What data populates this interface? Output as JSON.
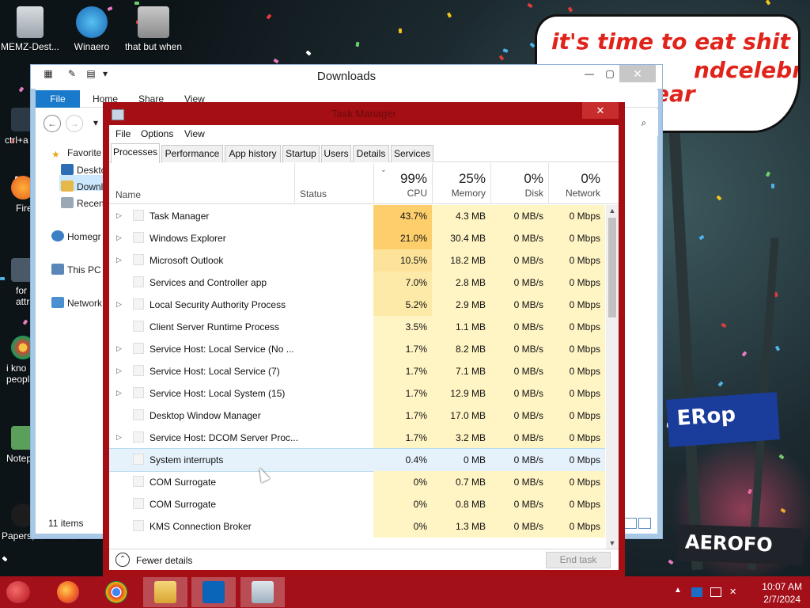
{
  "desktop": {
    "icons_top": [
      {
        "label": "MEMZ-Dest..."
      },
      {
        "label": "Winaero Tweaker"
      },
      {
        "label": "that but when its c#"
      }
    ],
    "icons_left": [
      {
        "label": "ctrl+a"
      },
      {
        "label": "Fire"
      },
      {
        "label": "for attra"
      },
      {
        "label": "i kno peopl"
      },
      {
        "label": "Notep"
      },
      {
        "label": "Papers, Please Forza Ho"
      }
    ],
    "overlay_text": [
      "it's time to eat shit",
      "ndcelebrate",
      "ear"
    ],
    "sign_text": "ERop",
    "sign_text_2": "AEROFO"
  },
  "explorer": {
    "title": "Downloads",
    "ribbon_tabs": [
      "File",
      "Home",
      "Share",
      "View"
    ],
    "sidebar": {
      "favorites": "Favorite",
      "items": [
        "Deskto",
        "Downl",
        "Recen"
      ],
      "homegroup": "Homegr",
      "this_pc": "This PC",
      "network": "Network"
    },
    "status": "11 items"
  },
  "taskmanager": {
    "title": "Task Manager",
    "menu": [
      "File",
      "Options",
      "View"
    ],
    "tabs": [
      "Processes",
      "Performance",
      "App history",
      "Startup",
      "Users",
      "Details",
      "Services"
    ],
    "active_tab": "Processes",
    "columns": {
      "name": "Name",
      "status": "Status",
      "cpu": {
        "pct": "99%",
        "label": "CPU"
      },
      "memory": {
        "pct": "25%",
        "label": "Memory"
      },
      "disk": {
        "pct": "0%",
        "label": "Disk"
      },
      "network": {
        "pct": "0%",
        "label": "Network"
      }
    },
    "processes": [
      {
        "name": "Task Manager",
        "expandable": true,
        "cpu": "43.7%",
        "mem": "4.3 MB",
        "disk": "0 MB/s",
        "net": "0 Mbps"
      },
      {
        "name": "Windows Explorer",
        "expandable": true,
        "cpu": "21.0%",
        "mem": "30.4 MB",
        "disk": "0 MB/s",
        "net": "0 Mbps"
      },
      {
        "name": "Microsoft Outlook",
        "expandable": true,
        "cpu": "10.5%",
        "mem": "18.2 MB",
        "disk": "0 MB/s",
        "net": "0 Mbps"
      },
      {
        "name": "Services and Controller app",
        "expandable": false,
        "cpu": "7.0%",
        "mem": "2.8 MB",
        "disk": "0 MB/s",
        "net": "0 Mbps"
      },
      {
        "name": "Local Security Authority Process",
        "expandable": true,
        "cpu": "5.2%",
        "mem": "2.9 MB",
        "disk": "0 MB/s",
        "net": "0 Mbps"
      },
      {
        "name": "Client Server Runtime Process",
        "expandable": false,
        "cpu": "3.5%",
        "mem": "1.1 MB",
        "disk": "0 MB/s",
        "net": "0 Mbps"
      },
      {
        "name": "Service Host: Local Service (No ...",
        "expandable": true,
        "cpu": "1.7%",
        "mem": "8.2 MB",
        "disk": "0 MB/s",
        "net": "0 Mbps"
      },
      {
        "name": "Service Host: Local Service (7)",
        "expandable": true,
        "cpu": "1.7%",
        "mem": "7.1 MB",
        "disk": "0 MB/s",
        "net": "0 Mbps"
      },
      {
        "name": "Service Host: Local System (15)",
        "expandable": true,
        "cpu": "1.7%",
        "mem": "12.9 MB",
        "disk": "0 MB/s",
        "net": "0 Mbps"
      },
      {
        "name": "Desktop Window Manager",
        "expandable": false,
        "cpu": "1.7%",
        "mem": "17.0 MB",
        "disk": "0 MB/s",
        "net": "0 Mbps"
      },
      {
        "name": "Service Host: DCOM Server Proc...",
        "expandable": true,
        "cpu": "1.7%",
        "mem": "3.2 MB",
        "disk": "0 MB/s",
        "net": "0 Mbps"
      },
      {
        "name": "System interrupts",
        "expandable": false,
        "cpu": "0.4%",
        "mem": "0 MB",
        "disk": "0 MB/s",
        "net": "0 Mbps",
        "hover": true
      },
      {
        "name": "COM Surrogate",
        "expandable": false,
        "cpu": "0%",
        "mem": "0.7 MB",
        "disk": "0 MB/s",
        "net": "0 Mbps"
      },
      {
        "name": "COM Surrogate",
        "expandable": false,
        "cpu": "0%",
        "mem": "0.8 MB",
        "disk": "0 MB/s",
        "net": "0 Mbps"
      },
      {
        "name": "KMS Connection Broker",
        "expandable": false,
        "cpu": "0%",
        "mem": "1.3 MB",
        "disk": "0 MB/s",
        "net": "0 Mbps"
      }
    ],
    "footer": {
      "fewer_details": "Fewer details",
      "end_task": "End task"
    }
  },
  "taskbar": {
    "apps": [
      {
        "name": "Firefox"
      },
      {
        "name": "Chrome"
      },
      {
        "name": "File Explorer"
      },
      {
        "name": "Outlook"
      },
      {
        "name": "Task Manager",
        "active": true
      }
    ],
    "clock": {
      "time": "10:07 AM",
      "date": "2/7/2024"
    }
  },
  "colors": {
    "tm_frame": "#a50e13",
    "taskbar": "#a3101a",
    "cpu_heat_high": "#fdd27a",
    "cpu_heat_low": "#fff4c4",
    "explorer_accent": "#1979ca"
  }
}
